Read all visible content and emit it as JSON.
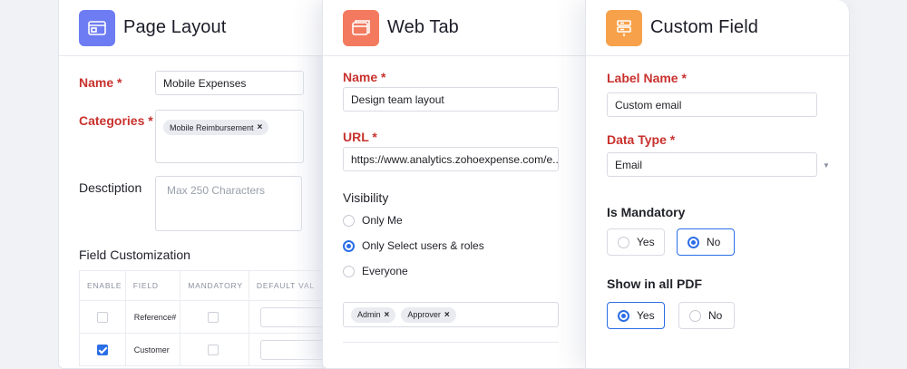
{
  "page_layout": {
    "title": "Page Layout",
    "icon": "layout-icon",
    "icon_color": "#6d7cf2",
    "name_label": "Name *",
    "name_value": "Mobile Expenses",
    "categories_label": "Categories *",
    "category_chip": "Mobile Reimbursement",
    "description_label": "Desctiption",
    "description_placeholder": "Max 250 Characters",
    "field_customization_label": "Field Customization",
    "table": {
      "headers": [
        "ENABLE",
        "FIELD",
        "MANDATORY",
        "DEFAULT VAL"
      ],
      "rows": [
        {
          "field": "Reference#",
          "enabled": false
        },
        {
          "field": "Customer",
          "enabled": true
        }
      ]
    }
  },
  "web_tab": {
    "title": "Web Tab",
    "icon": "browser-tab-icon",
    "icon_color": "#f37a5e",
    "name_label": "Name *",
    "name_value": "Design team layout",
    "url_label": "URL *",
    "url_value": "https://www.analytics.zohoexpense.com/e..",
    "visibility_label": "Visibility",
    "visibility_options": [
      "Only Me",
      "Only Select users & roles",
      "Everyone"
    ],
    "visibility_selected": 1,
    "role_chips": [
      "Admin",
      "Approver"
    ]
  },
  "custom_field": {
    "title": "Custom Field",
    "icon": "form-field-icon",
    "icon_color": "#f7a24a",
    "label_name_label": "Label Name *",
    "label_name_value": "Custom email",
    "data_type_label": "Data Type *",
    "data_type_value": "Email",
    "mandatory_label": "Is Mandatory",
    "mandatory_options": [
      "Yes",
      "No"
    ],
    "mandatory_selected": 1,
    "pdf_label": "Show in all PDF",
    "pdf_options": [
      "Yes",
      "No"
    ],
    "pdf_selected": 0
  },
  "colors": {
    "accent_blue": "#2b6ee6",
    "label_red": "#c8322e"
  }
}
